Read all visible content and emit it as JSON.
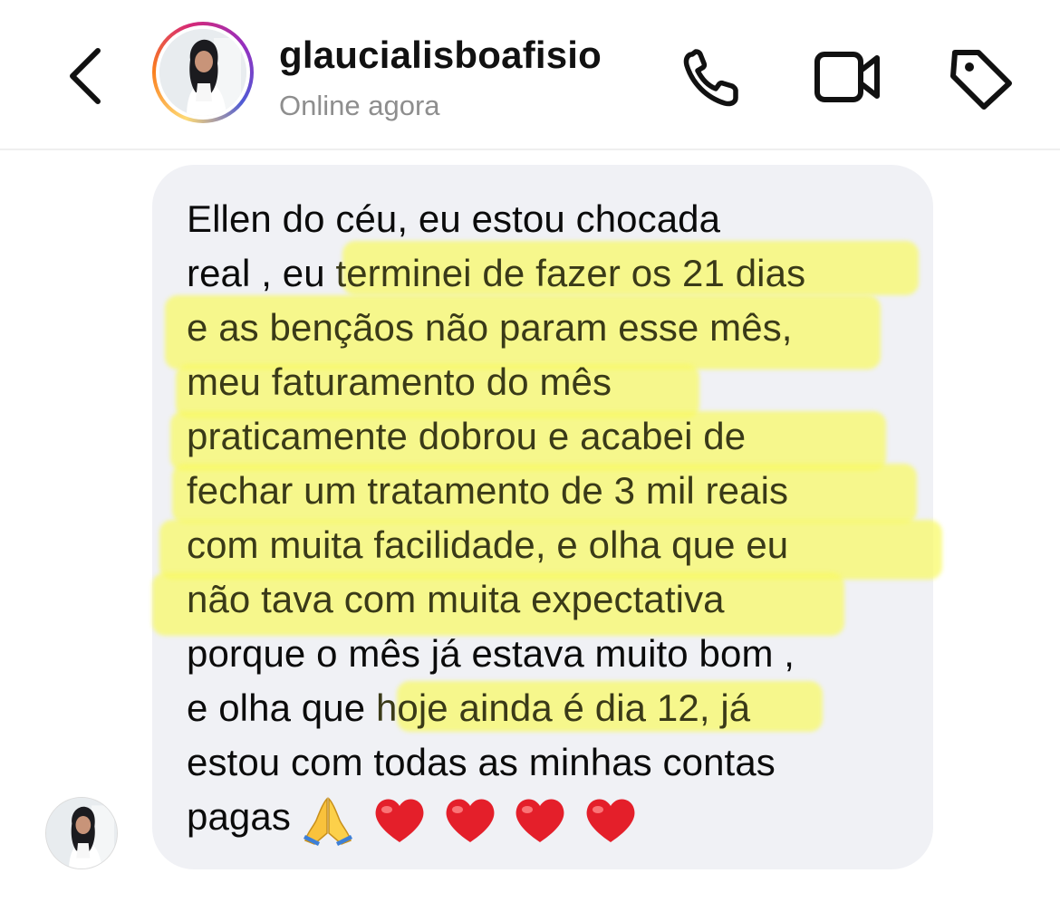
{
  "header": {
    "username": "glaucialisboafisio",
    "status": "Online agora"
  },
  "icons": {
    "back": "chevron-left-icon",
    "phone": "phone-icon",
    "video": "video-camera-icon",
    "tag": "tag-icon"
  },
  "colors": {
    "highlight": "#f8fa64",
    "bubble": "#f0f1f5",
    "text": "#0b0b0b",
    "status": "#8e8e8e",
    "heart": "#e41f2a"
  },
  "message": {
    "lines": [
      {
        "pre": "Ellen do céu, eu estou chocada",
        "hl": ""
      },
      {
        "pre": "real , eu ",
        "hl": "terminei de fazer os 21 dias"
      },
      {
        "pre": "",
        "hl": "e as bençãos não param esse mês,"
      },
      {
        "pre": "",
        "hl": "meu faturamento do mês"
      },
      {
        "pre": "",
        "hl": "praticamente dobrou e acabei de"
      },
      {
        "pre": "",
        "hl": "fechar um tratamento de 3 mil reais"
      },
      {
        "pre": "",
        "hl": "com muita facilidade, e olha que eu"
      },
      {
        "pre": "",
        "hl": "não tava com muita expectativa"
      },
      {
        "pre": "porque o mês já estava muito bom ,",
        "hl": ""
      },
      {
        "pre": "e olha que ",
        "hl": "hoje ainda é dia 12, já"
      },
      {
        "pre": "estou com todas as minhas contas",
        "hl": ""
      },
      {
        "pre": "pagas",
        "hl": ""
      }
    ],
    "emojis": [
      "folded-hands-emoji",
      "red-heart-emoji",
      "red-heart-emoji",
      "red-heart-emoji",
      "red-heart-emoji"
    ]
  }
}
